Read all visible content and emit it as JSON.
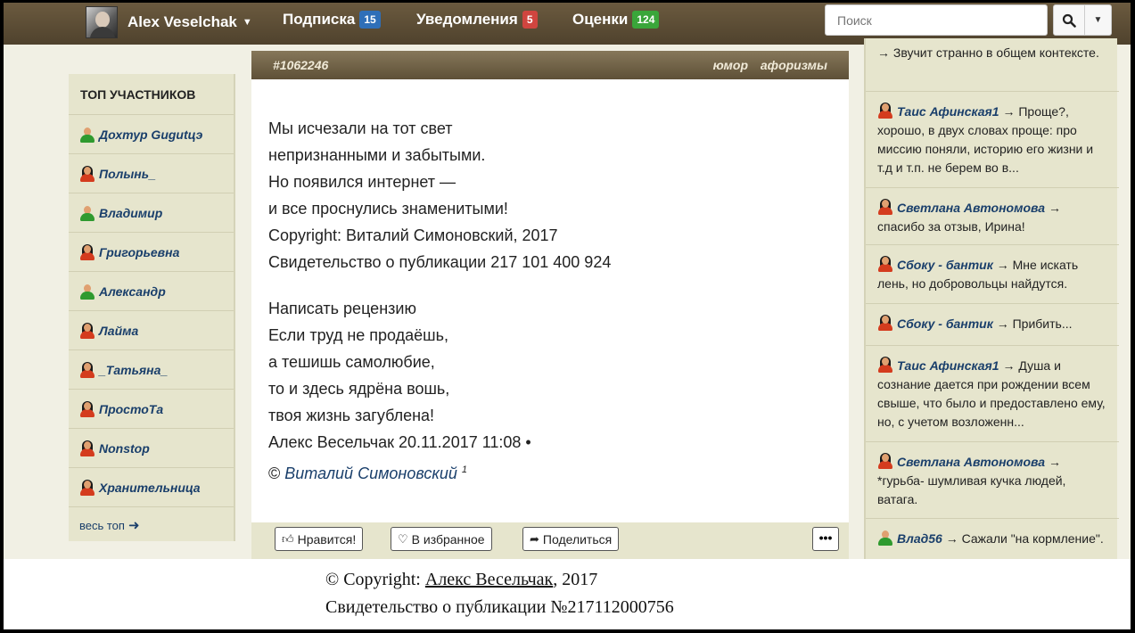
{
  "nav": {
    "username": "Alex Veselchak",
    "subscription_label": "Подписка",
    "subscription_count": "15",
    "notifications_label": "Уведомления",
    "notifications_count": "5",
    "ratings_label": "Оценки",
    "ratings_count": "124",
    "search_placeholder": "Поиск",
    "colors": {
      "navbar": "#5c4d35",
      "badge_blue": "#2f6fb8",
      "badge_red": "#d0453f",
      "badge_green": "#3aa63a"
    }
  },
  "left": {
    "title": "ТОП УЧАСТНИКОВ",
    "members": [
      {
        "name": "Дохтур Gugutцэ",
        "gender": "male"
      },
      {
        "name": "Полынь_",
        "gender": "female"
      },
      {
        "name": "Владимир",
        "gender": "male"
      },
      {
        "name": "Григорьевна",
        "gender": "female"
      },
      {
        "name": "Александр",
        "gender": "male"
      },
      {
        "name": "Лайма",
        "gender": "female"
      },
      {
        "name": "_Татьяна_",
        "gender": "female"
      },
      {
        "name": "ПростоТа",
        "gender": "female"
      },
      {
        "name": "Nonstop",
        "gender": "female"
      },
      {
        "name": "Хранительница",
        "gender": "female"
      }
    ],
    "all_top": "весь топ"
  },
  "post": {
    "id": "#1062246",
    "tags": [
      "юмор",
      "афоризмы"
    ],
    "lines1": [
      "Мы исчезали на тот свет",
      "непризнанными и забытыми.",
      "Но появился интернет —",
      "и все проснулись знаменитыми!",
      "Copyright: Виталий Симоновский, 2017",
      "Свидетельство о публикации 217 101 400 924"
    ],
    "lines2": [
      "Написать рецензию",
      "Если труд не продаёшь,",
      "а тешишь самолюбие,",
      "то и здесь ядрёна вошь,",
      "твоя жизнь загублена!",
      "Алекс Весельчак 20.11.2017 11:08 •"
    ],
    "author_prefix": "©",
    "author": "Виталий Симоновский",
    "author_sup": "1",
    "like_label": "Нравится!",
    "fav_label": "В избранное",
    "share_label": "Поделиться",
    "more_label": "•••"
  },
  "right": {
    "comments": [
      {
        "name": "",
        "gender": "",
        "text": "→ Звучит странно в общем контексте."
      },
      {
        "name": "Таис Афинская1",
        "gender": "female",
        "text": "→ Проще?, хорошо, в двух словах проще: про миссию поняли, историю его жизни и т.д и т.п. не берем во в..."
      },
      {
        "name": "Светлана Автономова",
        "gender": "female",
        "text": "→ спасибо за отзыв, Ирина!"
      },
      {
        "name": "Сбоку - бантик",
        "gender": "female",
        "text": "→ Мне искать лень, но добровольцы найдутся."
      },
      {
        "name": "Сбоку - бантик",
        "gender": "female",
        "text": "→ Прибить..."
      },
      {
        "name": "Таис Афинская1",
        "gender": "female",
        "text": "→ Душа и сознание дается при рождении всем свыше, что было и предоставлено ему, но, с учетом возложенн..."
      },
      {
        "name": "Светлана Автономова",
        "gender": "female",
        "text": "→ *гурьба- шумливая кучка людей, ватага."
      },
      {
        "name": "Влад56",
        "gender": "male",
        "text": "→ Сажали \"на кормление\"."
      }
    ]
  },
  "copyright": {
    "prefix": "© Copyright:",
    "author": "Алекс Весельчак",
    "year": ", 2017",
    "certificate": "Свидетельство о публикации №217112000756"
  }
}
